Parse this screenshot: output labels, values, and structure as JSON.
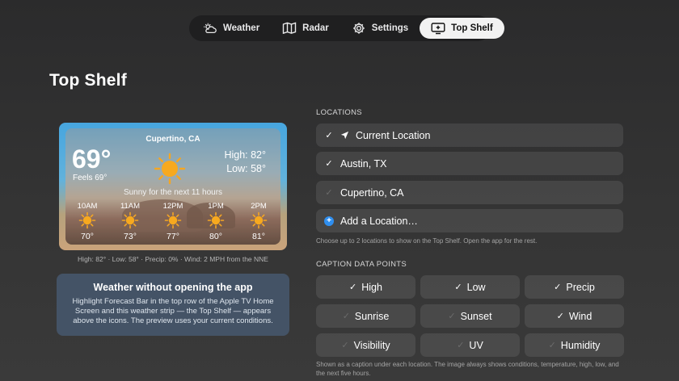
{
  "tabs": [
    {
      "label": "Weather",
      "icon": "weather-icon"
    },
    {
      "label": "Radar",
      "icon": "map-icon"
    },
    {
      "label": "Settings",
      "icon": "gear-icon"
    },
    {
      "label": "Top Shelf",
      "icon": "tv-icon",
      "selected": true
    }
  ],
  "page_title": "Top Shelf",
  "preview": {
    "city": "Cupertino, CA",
    "temp": "69°",
    "feels": "Feels 69°",
    "high": "High: 82°",
    "low": "Low: 58°",
    "summary": "Sunny for the next 11 hours",
    "hours": [
      {
        "label": "10AM",
        "temp": "70°",
        "icon": "sun-icon"
      },
      {
        "label": "11AM",
        "temp": "73°",
        "icon": "sun-icon"
      },
      {
        "label": "12PM",
        "temp": "77°",
        "icon": "sun-icon"
      },
      {
        "label": "1PM",
        "temp": "80°",
        "icon": "sun-icon"
      },
      {
        "label": "2PM",
        "temp": "81°",
        "icon": "sun-icon"
      }
    ],
    "caption": "High: 82° · Low: 58° · Precip: 0% · Wind: 2 MPH from the NNE"
  },
  "info": {
    "title": "Weather without opening the app",
    "body": "Highlight Forecast Bar in the top row of the Apple TV Home Screen and this weather strip — the Top Shelf — appears above the icons. The preview uses your current conditions."
  },
  "locations": {
    "header": "LOCATIONS",
    "items": [
      {
        "label": "Current Location",
        "checked": true,
        "icon": "location-arrow-icon"
      },
      {
        "label": "Austin, TX",
        "checked": true
      },
      {
        "label": "Cupertino, CA",
        "checked": false
      }
    ],
    "add_label": "Add a Location…",
    "helper": "Choose up to 2 locations to show on the Top Shelf. Open the app for the rest."
  },
  "caption_points": {
    "header": "CAPTION DATA POINTS",
    "items": [
      {
        "label": "High",
        "checked": true
      },
      {
        "label": "Low",
        "checked": true
      },
      {
        "label": "Precip",
        "checked": true
      },
      {
        "label": "Sunrise",
        "checked": false
      },
      {
        "label": "Sunset",
        "checked": false
      },
      {
        "label": "Wind",
        "checked": true
      },
      {
        "label": "Visibility",
        "checked": false
      },
      {
        "label": "UV",
        "checked": false
      },
      {
        "label": "Humidity",
        "checked": false
      }
    ],
    "helper": "Shown as a caption under each location. The image always shows conditions, temperature, high, low, and the next five hours."
  },
  "colors": {
    "accent": "#2f8ff0",
    "sun": "#f5a623",
    "selected_tab": "#f2f2f2"
  }
}
